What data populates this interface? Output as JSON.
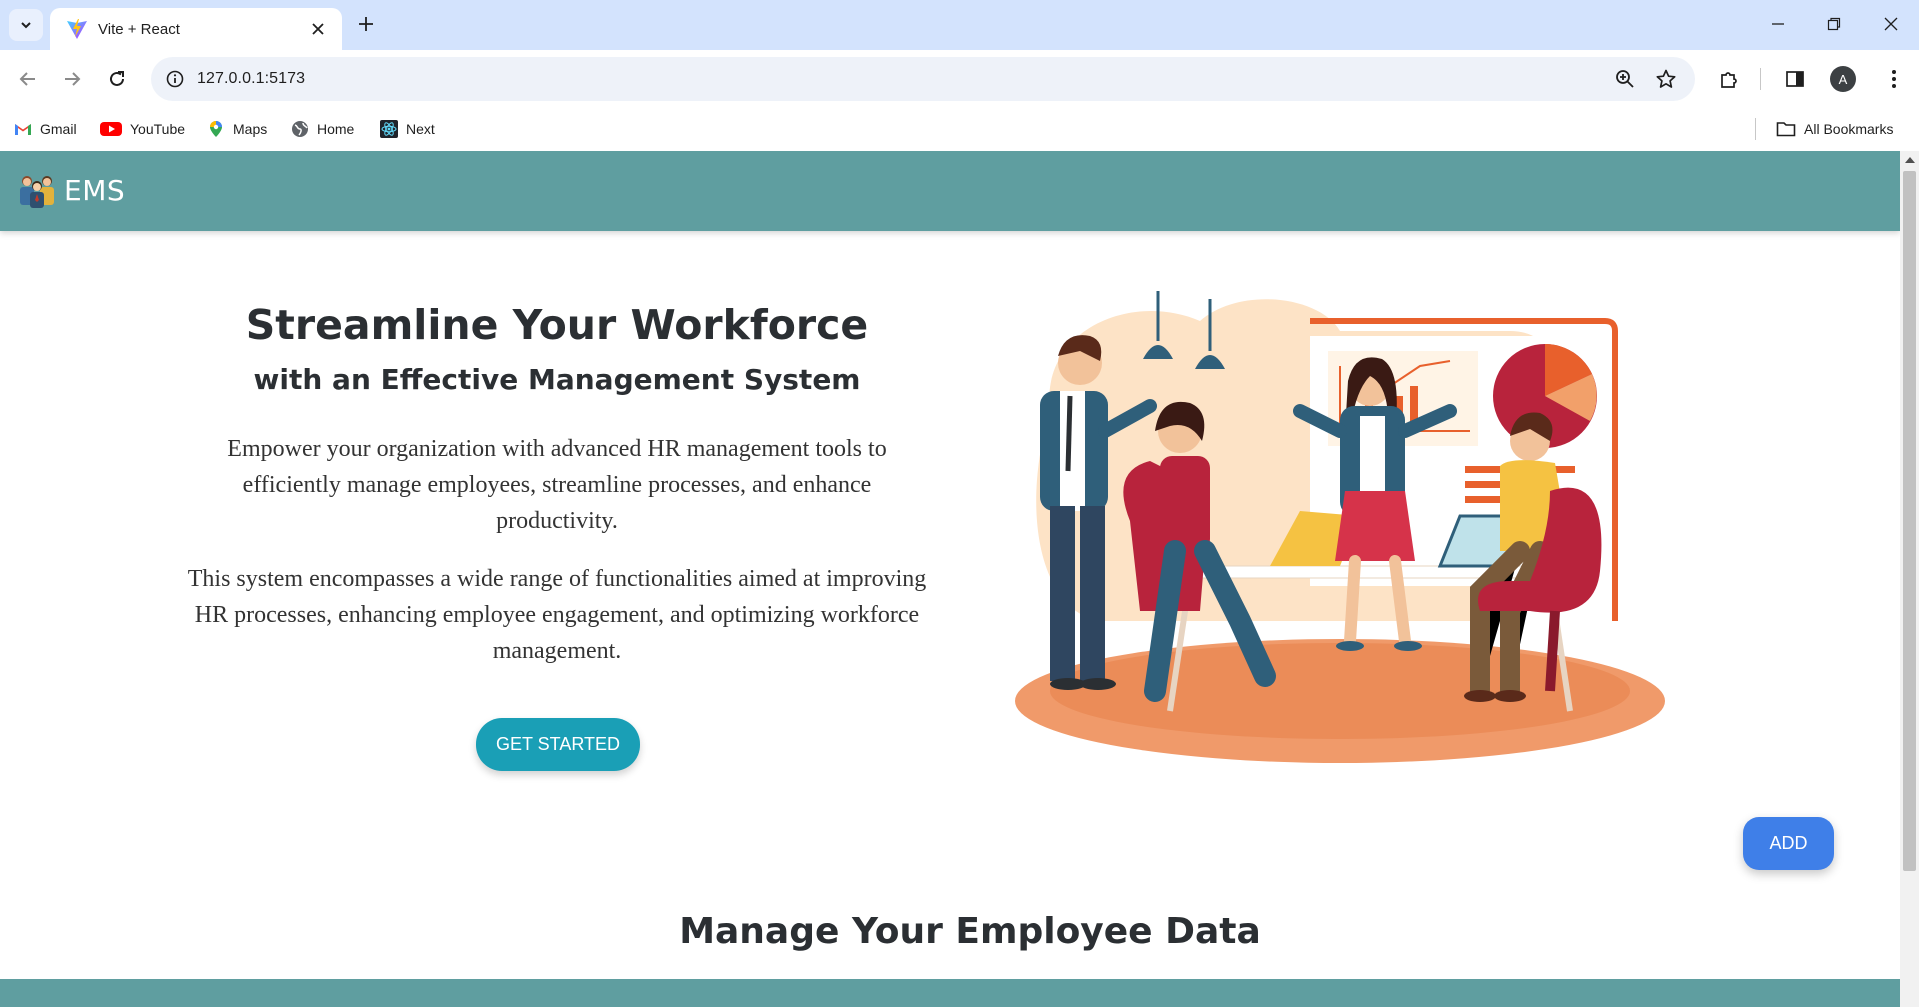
{
  "browser": {
    "tab_title": "Vite + React",
    "url": "127.0.0.1:5173",
    "avatar_letter": "A",
    "bookmarks": [
      {
        "label": "Gmail",
        "icon": "gmail-icon"
      },
      {
        "label": "YouTube",
        "icon": "youtube-icon"
      },
      {
        "label": "Maps",
        "icon": "maps-icon"
      },
      {
        "label": "Home",
        "icon": "globe-icon"
      },
      {
        "label": "Next",
        "icon": "react-icon"
      }
    ],
    "all_bookmarks": "All Bookmarks"
  },
  "navbar": {
    "brand": "EMS",
    "brand_icon": "team-icon",
    "color": "#5f9ea0"
  },
  "hero": {
    "title": "Streamline Your Workforce",
    "subtitle": "with an Effective Management System",
    "paragraph1": "Empower your organization with advanced HR management tools to efficiently manage employees, streamline processes, and enhance productivity.",
    "paragraph2": "This system encompasses a wide range of functionalities aimed at improving HR processes, enhancing employee engagement, and optimizing workforce management.",
    "cta_label": "GET STARTED",
    "cta_color": "#1a9fb6"
  },
  "add_button": {
    "label": "ADD",
    "color": "#3f7fe8"
  },
  "section": {
    "title": "Manage Your Employee Data"
  }
}
